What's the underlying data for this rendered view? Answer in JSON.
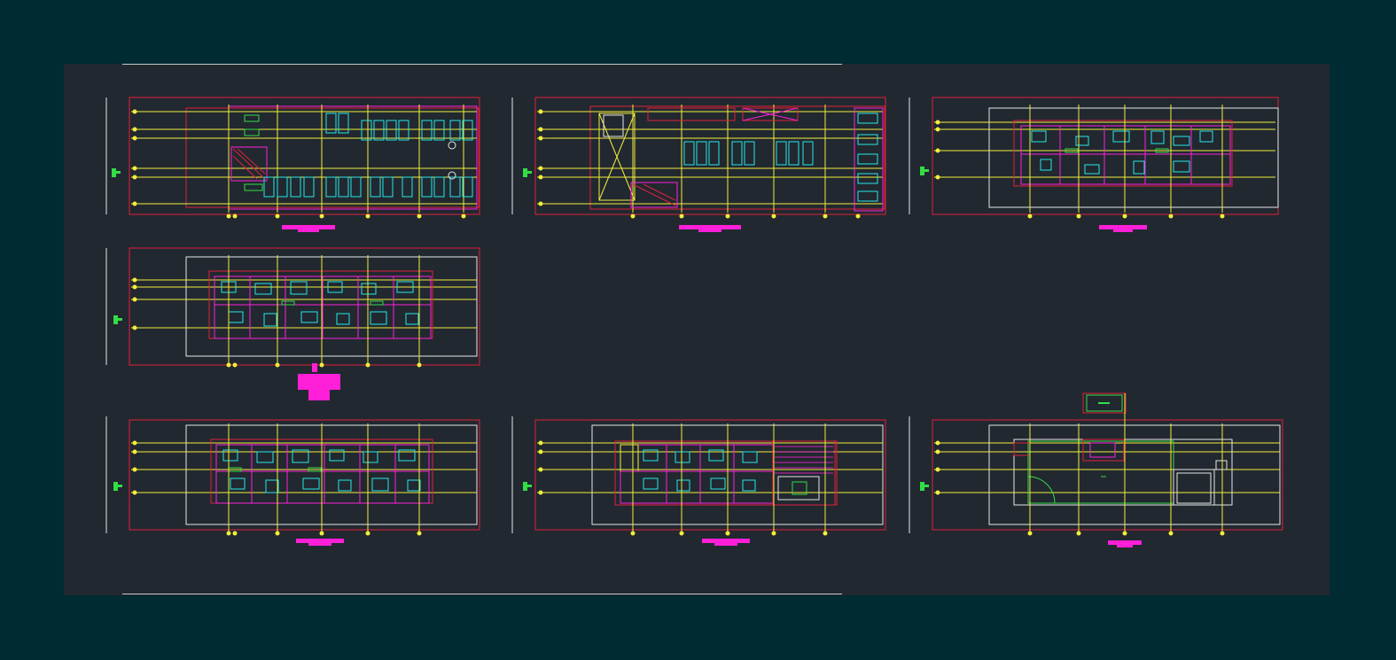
{
  "sheet": {
    "background": "#002b33",
    "paper": "#212830"
  },
  "colors": {
    "red": "#e0203a",
    "yellow": "#f2ee3c",
    "cyan": "#25e8e8",
    "magenta": "#ff1fd8",
    "green": "#33dd44",
    "white": "#e6e6e6",
    "blue": "#2a55ff",
    "orange": "#ff8a2a"
  },
  "plans": [
    {
      "id": "plan-1",
      "type": "parking",
      "grid_rows": 6,
      "grid_cols": 11
    },
    {
      "id": "plan-2",
      "type": "parking-with-stair",
      "grid_rows": 6,
      "grid_cols": 9
    },
    {
      "id": "plan-3",
      "type": "apartments",
      "grid_rows": 4,
      "grid_cols": 7
    },
    {
      "id": "plan-4",
      "type": "apartments",
      "grid_rows": 4,
      "grid_cols": 7
    },
    {
      "id": "plan-5",
      "type": "apartments",
      "grid_rows": 4,
      "grid_cols": 7
    },
    {
      "id": "plan-6",
      "type": "apartments-with-terrace",
      "grid_rows": 4,
      "grid_cols": 7
    },
    {
      "id": "plan-7",
      "type": "roof",
      "grid_rows": 4,
      "grid_cols": 7
    }
  ]
}
